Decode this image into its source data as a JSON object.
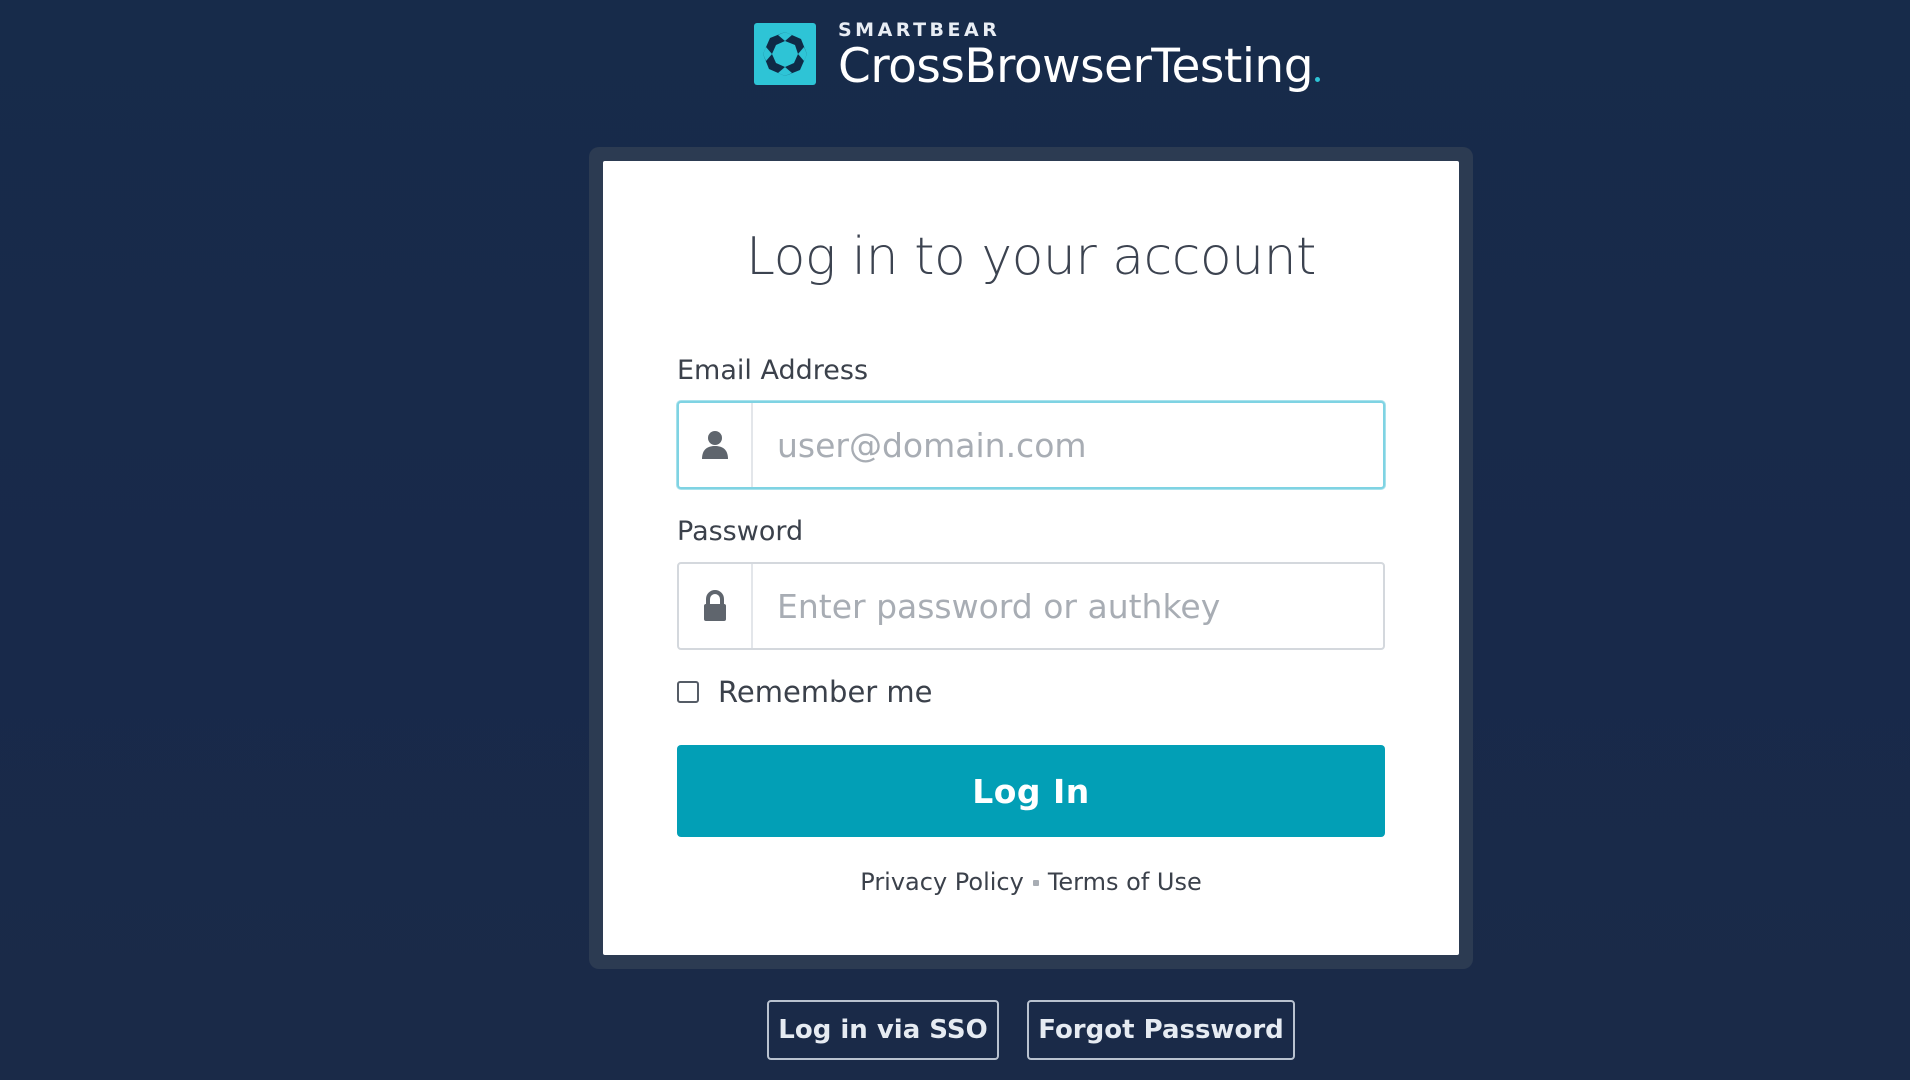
{
  "brand": {
    "company": "SMARTBEAR",
    "product": "CrossBrowserTesting",
    "logo_icon": "crossbrowsertesting-logo-icon",
    "accent_color": "#2ec4d6"
  },
  "login_card": {
    "title": "Log in to your account",
    "email": {
      "label": "Email Address",
      "placeholder": "user@domain.com",
      "value": "",
      "icon": "user-icon"
    },
    "password": {
      "label": "Password",
      "placeholder": "Enter password or authkey",
      "value": "",
      "icon": "lock-icon"
    },
    "remember_me": {
      "label": "Remember me",
      "checked": false
    },
    "login_button": {
      "label": "Log In",
      "color": "#029fb6"
    },
    "legal_links": {
      "privacy": "Privacy Policy",
      "terms": "Terms of Use"
    }
  },
  "secondary_actions": {
    "sso_label": "Log in via SSO",
    "forgot_label": "Forgot Password"
  },
  "colors": {
    "background": "#182a47",
    "card_frame": "#2c3b52",
    "card": "#ffffff"
  }
}
